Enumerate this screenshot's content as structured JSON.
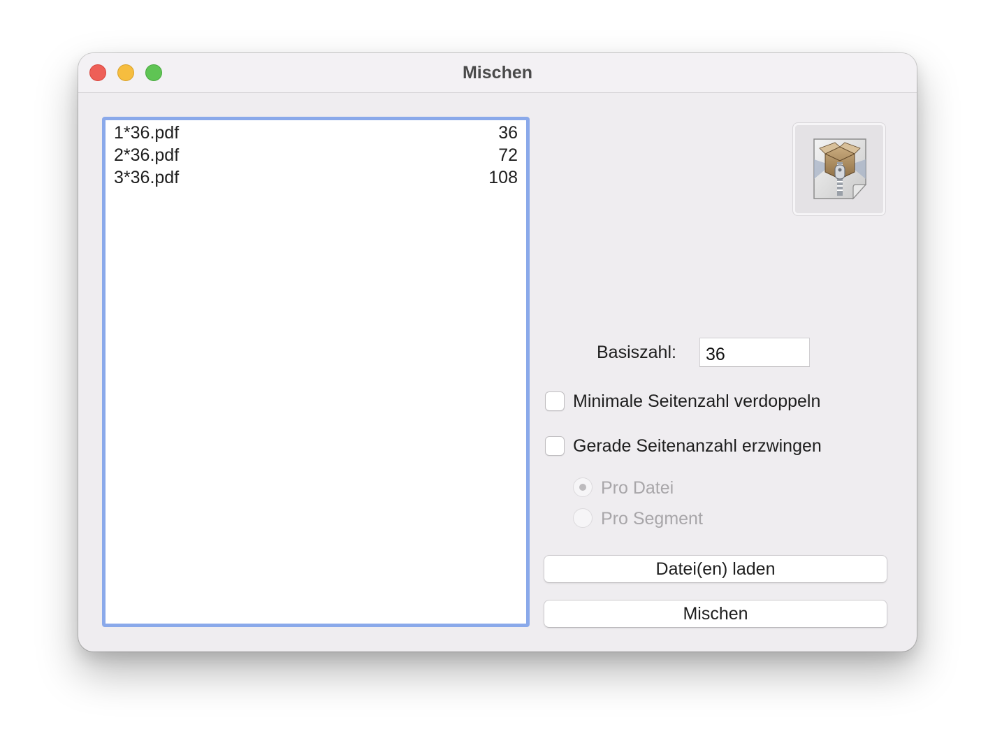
{
  "window": {
    "title": "Mischen"
  },
  "file_list": [
    {
      "name": "1*36.pdf",
      "pages": "36"
    },
    {
      "name": "2*36.pdf",
      "pages": "72"
    },
    {
      "name": "3*36.pdf",
      "pages": "108"
    }
  ],
  "app_icon": "zipped-archive-box-icon",
  "options": {
    "basis_label": "Basiszahl:",
    "basis_value": "36",
    "double_min_label": "Minimale Seitenzahl verdoppeln",
    "double_min_checked": false,
    "force_even_label": "Gerade Seitenanzahl erzwingen",
    "force_even_checked": false,
    "radio_per_file_label": "Pro Datei",
    "radio_per_segment_label": "Pro Segment",
    "radio_selected": "Pro Datei",
    "radios_enabled": false
  },
  "buttons": {
    "load_label": "Datei(en) laden",
    "merge_label": "Mischen"
  },
  "colors": {
    "list_focus_ring": "#8aa9ea",
    "close": "#ee5f57",
    "minimize": "#f6bd3f",
    "zoom": "#5fc454"
  }
}
